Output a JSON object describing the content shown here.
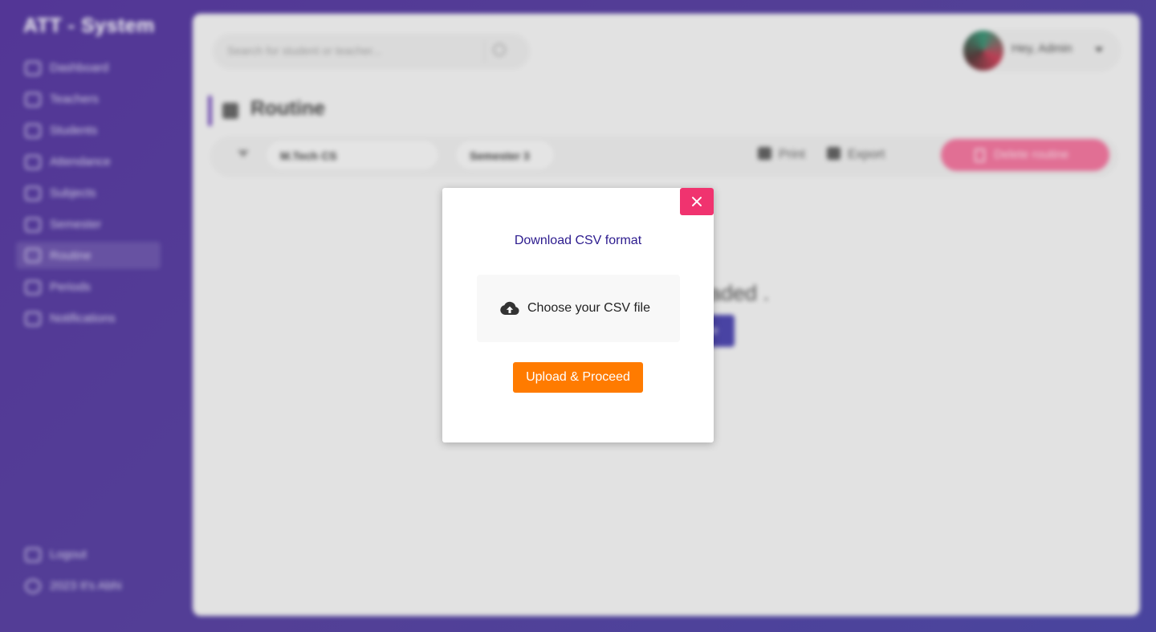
{
  "app": {
    "brand": "ATT - System"
  },
  "sidebar": {
    "items": [
      {
        "label": "Dashboard",
        "icon": "dashboard-icon"
      },
      {
        "label": "Teachers",
        "icon": "teacher-icon"
      },
      {
        "label": "Students",
        "icon": "students-icon"
      },
      {
        "label": "Attendance",
        "icon": "chart-line-icon"
      },
      {
        "label": "Subjects",
        "icon": "subjects-icon"
      },
      {
        "label": "Semester",
        "icon": "book-icon"
      },
      {
        "label": "Routine",
        "icon": "table-icon",
        "active": true
      },
      {
        "label": "Periods",
        "icon": "clock-file-icon"
      },
      {
        "label": "Notifications",
        "icon": "bell-icon"
      }
    ],
    "bottom": [
      {
        "label": "Logout",
        "icon": "logout-icon"
      },
      {
        "label": "2023 It's Abhi",
        "icon": "copyright-icon"
      }
    ]
  },
  "header": {
    "search_placeholder": "Search for student or teacher...",
    "user_greeting": "Hey, Admin"
  },
  "page": {
    "title": "Routine",
    "filters": {
      "course": "M.Tech CS",
      "semester": "Semester 3"
    },
    "print_label": "Print",
    "export_label": "Export",
    "delete_label": "Delete routine",
    "empty_message": "aded .",
    "empty_button": "e"
  },
  "modal": {
    "download_link": "Download CSV format",
    "file_picker_label": "Choose your CSV file",
    "proceed_label": "Upload & Proceed"
  },
  "colors": {
    "accent_purple": "#4a2a97",
    "close_pink": "#f0336f",
    "proceed_orange": "#ff7b00",
    "delete_pink": "#ec6a95",
    "link_indigo": "#2c1b8e"
  }
}
